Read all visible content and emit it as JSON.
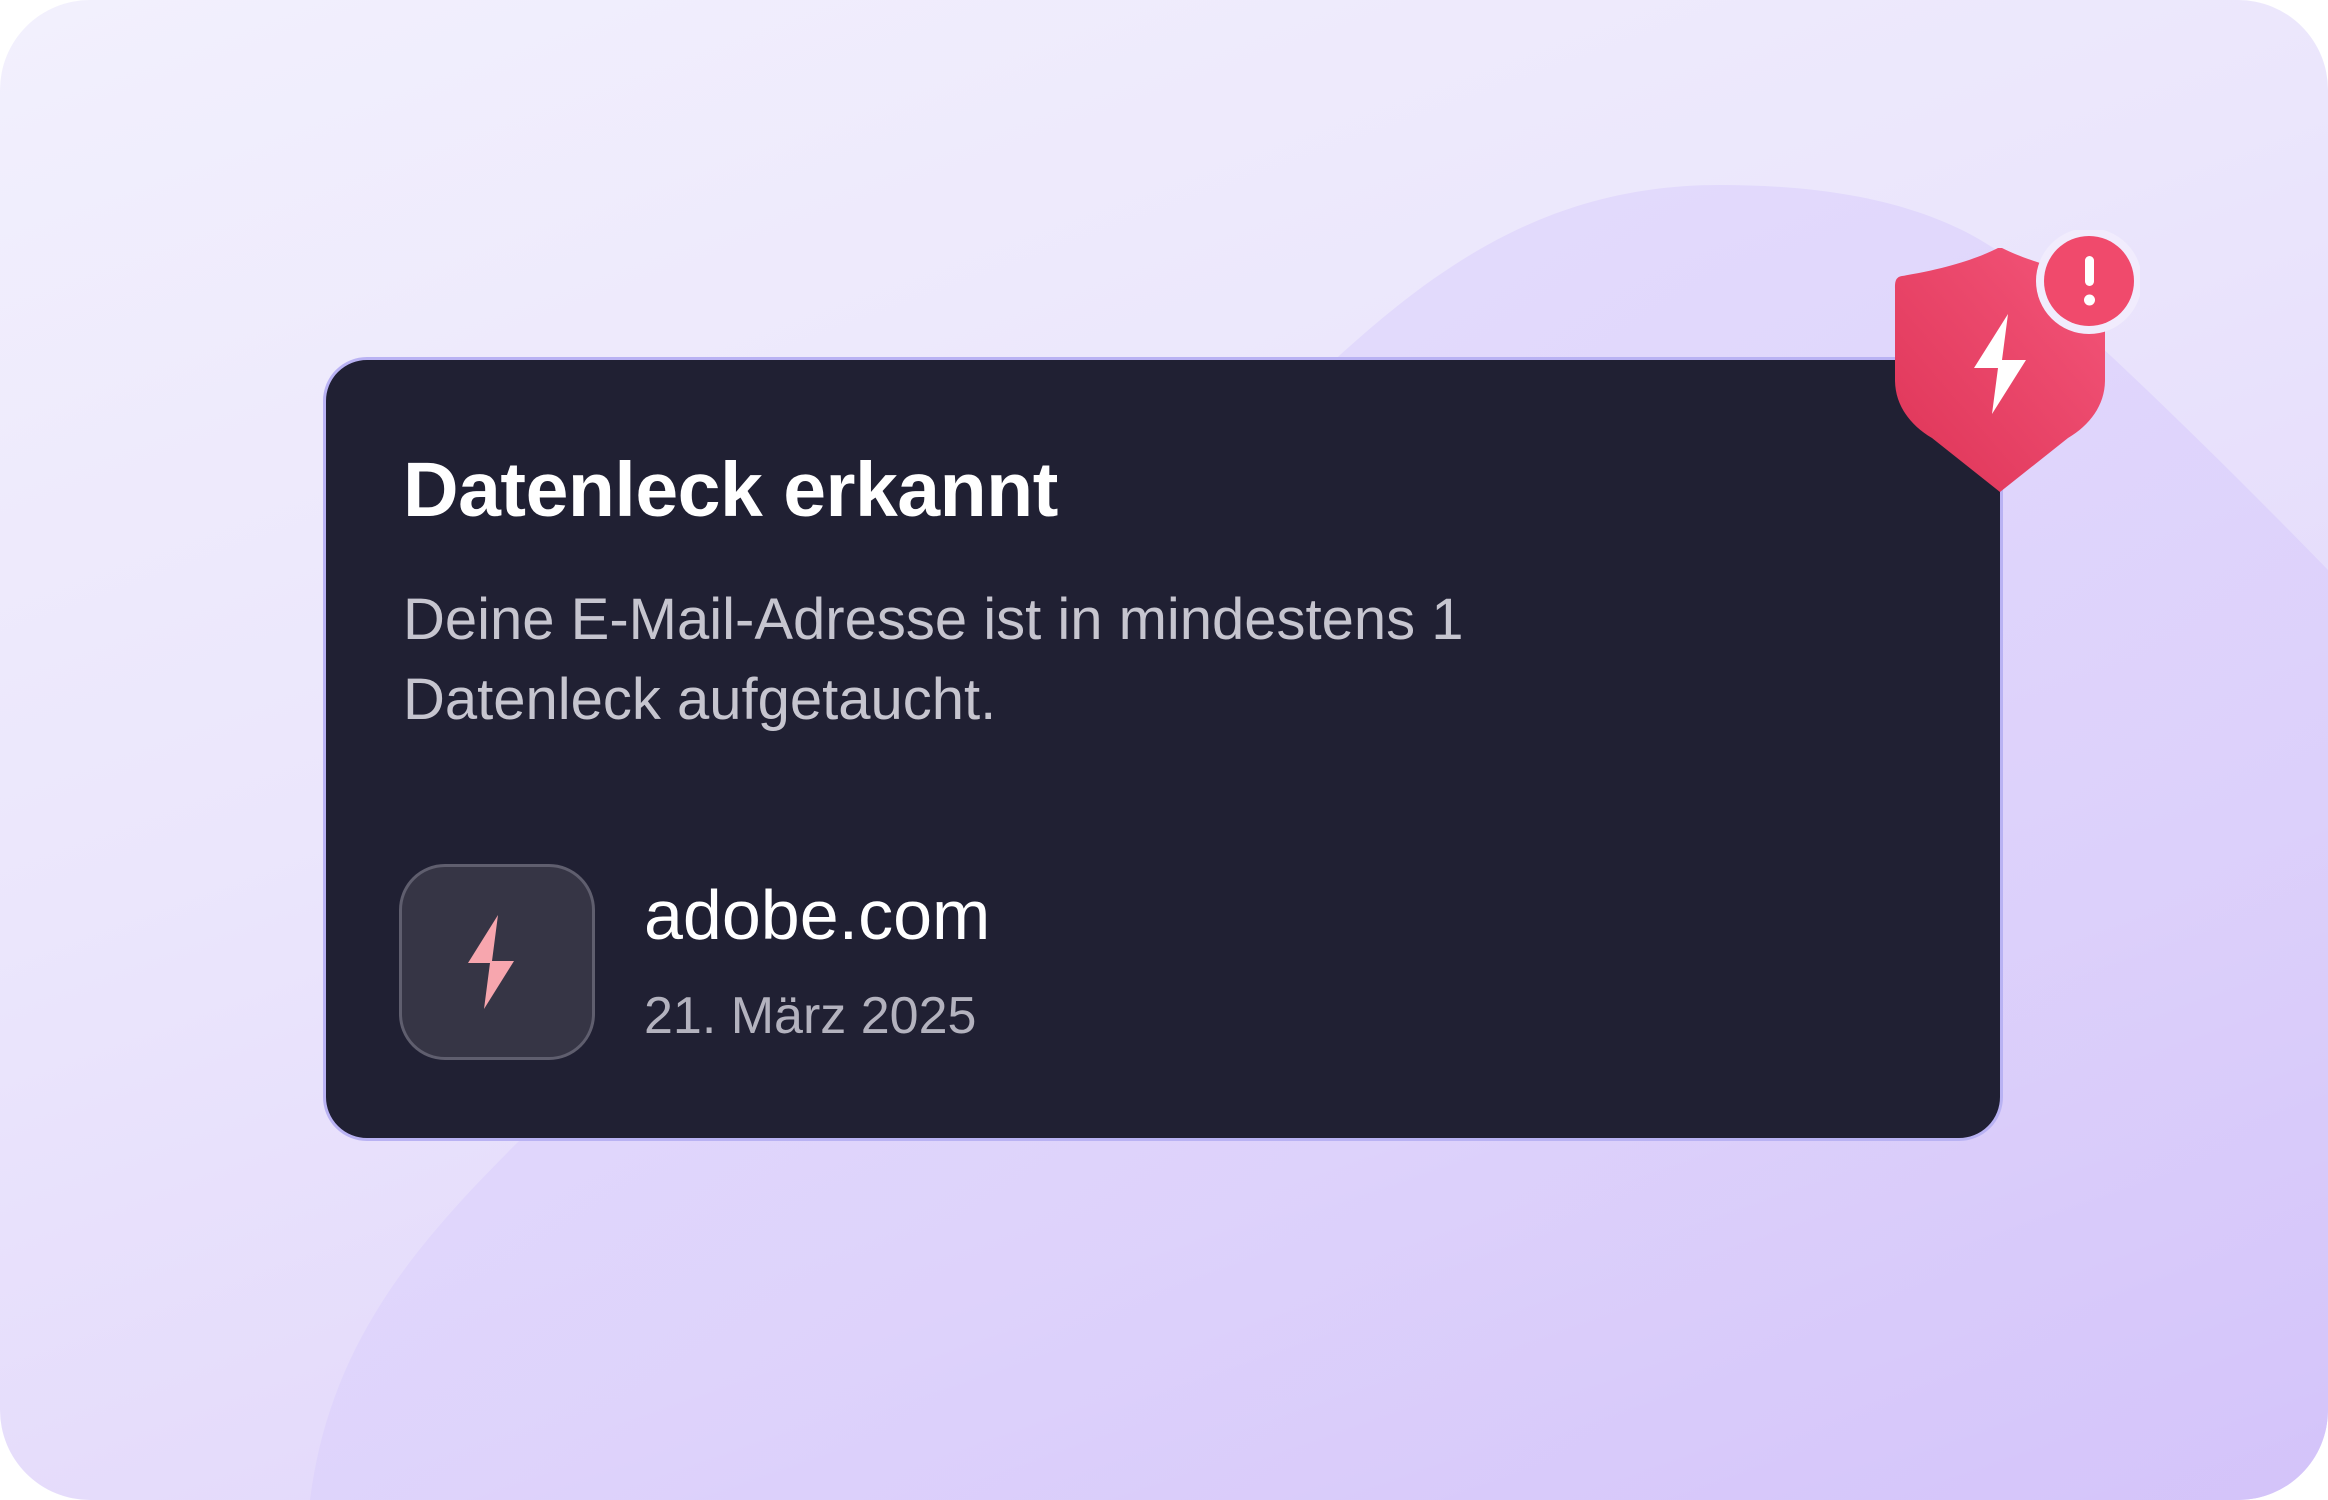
{
  "alert": {
    "title": "Datenleck erkannt",
    "description": "Deine E-Mail-Adresse ist in mindestens 1 Datenleck aufgetaucht.",
    "badge_icon": "shield-lightning-alert-icon"
  },
  "breach": {
    "site": "adobe.com",
    "date": "21. März 2025",
    "icon": "lightning-icon"
  },
  "colors": {
    "card_background": "#202033",
    "alert_red": "#e8405f",
    "accent_purple": "#b9b2f3",
    "lightning_pink": "#f7a6ae"
  }
}
